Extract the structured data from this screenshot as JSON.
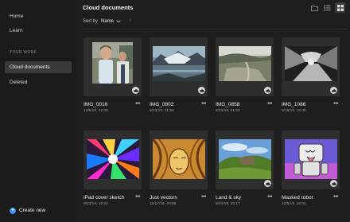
{
  "sidebar": {
    "items": [
      {
        "label": "Home"
      },
      {
        "label": "Learn"
      }
    ],
    "section_label": "YOUR WORK",
    "work_items": [
      {
        "label": "Cloud documents",
        "active": true
      },
      {
        "label": "Deleted",
        "active": false
      }
    ],
    "create_label": "Create new"
  },
  "header": {
    "title": "Cloud documents",
    "sort_label": "Sort by",
    "sort_value": "Name",
    "sort_direction": "↑"
  },
  "documents": [
    {
      "name": "IMG_0016",
      "date": "12/5/19, 22:05"
    },
    {
      "name": "IMG_0802",
      "date": "9/23/19, 21:55"
    },
    {
      "name": "IMG_0858",
      "date": "9/23/19, 21:22"
    },
    {
      "name": "IMG_1086",
      "date": "9/18/19, 16:30"
    },
    {
      "name": "iPad cover sketch",
      "date": "9/23/19, 19:24"
    },
    {
      "name": "Just vectors",
      "date": "12/17/19, 20:56"
    },
    {
      "name": "Land & sky",
      "date": "9/24/19, 20:17"
    },
    {
      "name": "Masked robot",
      "date": "12/5/19, 16:01"
    }
  ],
  "colors": {
    "accent": "#378ef0",
    "background": "#1e1e1e",
    "sidebar": "#1b1b1b",
    "card": "#2e2e2e"
  }
}
